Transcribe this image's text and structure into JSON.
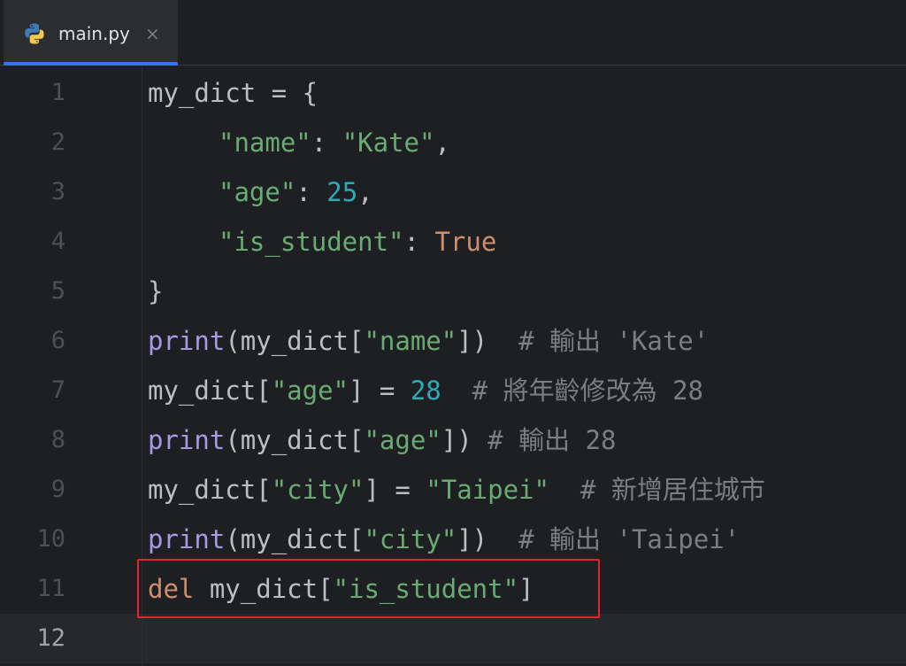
{
  "tab": {
    "icon": "python-icon",
    "label": "main.py",
    "close": "×"
  },
  "colors": {
    "background": "#1e1f22",
    "tab_accent": "#3574f0",
    "string": "#6aab73",
    "number": "#2aacb8",
    "keyword": "#cf8e6d",
    "builtin": "#a69ae3",
    "comment": "#7a7e85",
    "highlight_border": "#e0262c"
  },
  "editor": {
    "current_line": "12",
    "highlighted_line": "11",
    "lines": [
      {
        "n": "1",
        "tokens": [
          "my_dict = {"
        ]
      },
      {
        "n": "2",
        "tokens": [
          "\"name\"",
          ": ",
          "\"Kate\"",
          ","
        ]
      },
      {
        "n": "3",
        "tokens": [
          "\"age\"",
          ": ",
          "25",
          ","
        ]
      },
      {
        "n": "4",
        "tokens": [
          "\"is_student\"",
          ": ",
          "True"
        ]
      },
      {
        "n": "5",
        "tokens": [
          "}"
        ]
      },
      {
        "n": "6",
        "tokens": [
          "print",
          "(my_dict[",
          "\"name\"",
          "])  ",
          "# ",
          "輸出",
          " 'Kate'"
        ]
      },
      {
        "n": "7",
        "tokens": [
          "my_dict[",
          "\"age\"",
          "] = ",
          "28",
          "  # ",
          "將年齡修改為",
          " 28"
        ]
      },
      {
        "n": "8",
        "tokens": [
          "print",
          "(my_dict[",
          "\"age\"",
          "]) ",
          "# ",
          "輸出",
          " 28"
        ]
      },
      {
        "n": "9",
        "tokens": [
          "my_dict[",
          "\"city\"",
          "] = ",
          "\"Taipei\"",
          "  # ",
          "新增居住城市"
        ]
      },
      {
        "n": "10",
        "tokens": [
          "print",
          "(my_dict[",
          "\"city\"",
          "])  ",
          "# ",
          "輸出",
          " 'Taipei'"
        ]
      },
      {
        "n": "11",
        "tokens": [
          "del",
          " my_dict[",
          "\"is_student\"",
          "]"
        ]
      },
      {
        "n": "12",
        "tokens": []
      }
    ]
  }
}
